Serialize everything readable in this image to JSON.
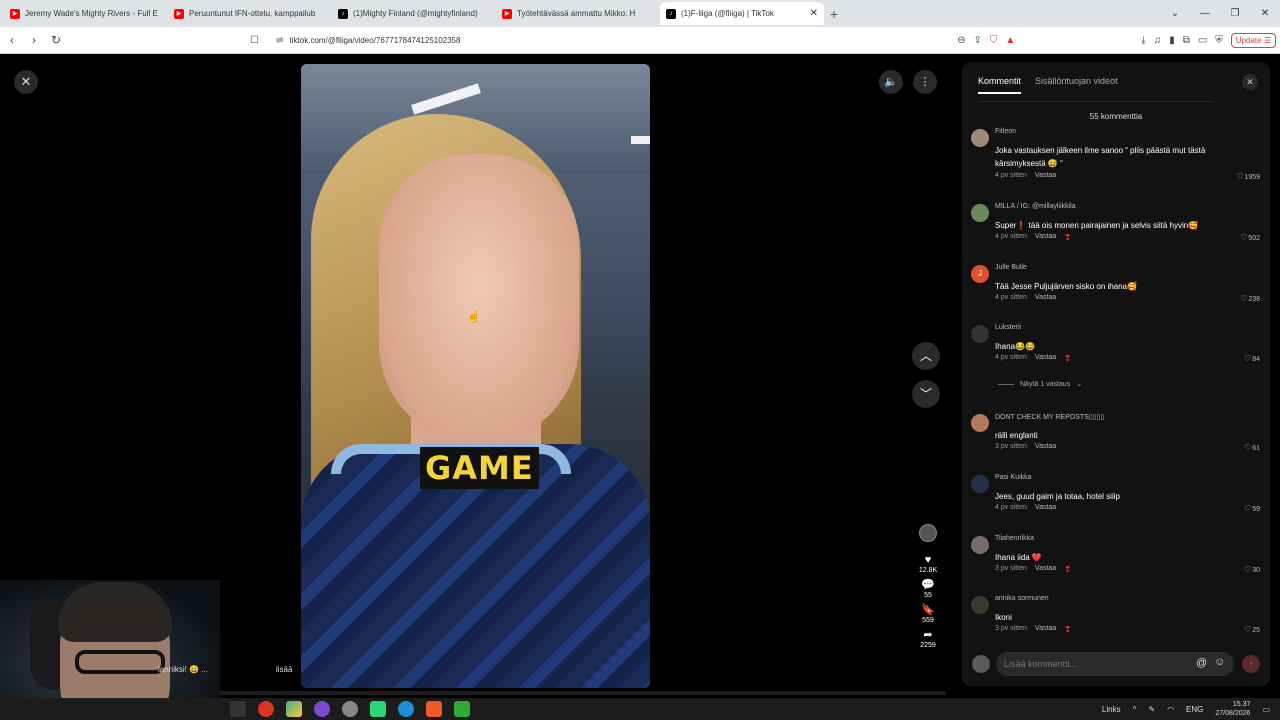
{
  "browser": {
    "tabs": [
      {
        "label": "Jeremy Wade's Mighty Rivers - Full E",
        "favicon_color": "#ff0000"
      },
      {
        "label": "Peruuntunut IFN-ottelu, kamppailub",
        "favicon_color": "#ff0000"
      },
      {
        "label": "(1)Mighty Finland (@mightyfinland)",
        "favicon_color": "#000000"
      },
      {
        "label": "Työtehtävässä ammattu Mikko: H",
        "favicon_color": "#ff0000"
      },
      {
        "label": "(1)F-liiga (@fliiga) | TikTok",
        "favicon_color": "#000000",
        "active": true
      }
    ],
    "url": "tiktok.com/@fliiga/video/7677178474125102358",
    "update_label": "Update"
  },
  "video": {
    "caption": "GAME",
    "description": "lanniksi! 😄 ...",
    "more_label": "lisää",
    "actions": {
      "likes": "12.8K",
      "comments": "55",
      "saves": "559",
      "shares": "2259"
    }
  },
  "panel": {
    "tabs": [
      "Kommentit",
      "Sisällöntuojan videot"
    ],
    "comment_count": "55 kommenttia",
    "show_replies": "Näytä 1 vastaus",
    "reply_label": "Vastaa",
    "input_placeholder": "Lisää kommentti...",
    "comments": [
      {
        "user": "Fitleon",
        "text": "Joka vastauksen jälkeen ilme sanoo “ pliis päästä mut tästä kärsimyksestä 😅 “",
        "time": "4 pv sitten",
        "likes": "1959",
        "avatar_color": "#a08b7a",
        "author_flag": false
      },
      {
        "user": "MILLA / IG: @millayliikkila",
        "text": "Super❗ tää ois monen pairajainen ja selvis siitä hyvin🥰",
        "time": "4 pv sitten",
        "likes": "502",
        "avatar_color": "#6d8a5c",
        "author_flag": true
      },
      {
        "user": "Julle Bulle",
        "text": "Tää Jesse Puljujärven sisko on ihana🥰",
        "time": "4 pv sitten",
        "likes": "238",
        "avatar_color": "#e0512d",
        "avatar_letter": "J",
        "author_flag": false
      },
      {
        "user": "Luksterii",
        "text": "Ihana😂😂",
        "time": "4 pv sitten",
        "likes": "84",
        "avatar_color": "#333333",
        "author_flag": true
      },
      {
        "user": "DONT CHECK MY REPOSTS▯▯▯▯",
        "text": "rälli englanti",
        "time": "3 pv sitten",
        "likes": "61",
        "avatar_color": "#b07a5a",
        "author_flag": false
      },
      {
        "user": "Pasi Kuikka",
        "text": "Jees, guud gaim ja totaa, hotel siiip",
        "time": "4 pv sitten",
        "likes": "59",
        "avatar_color": "#22304a",
        "author_flag": false
      },
      {
        "user": "Tiiahenriikka",
        "text": "Ihana iida ❤️",
        "time": "3 pv sitten",
        "likes": "30",
        "avatar_color": "#7a6a6a",
        "author_flag": true
      },
      {
        "user": "annika sormunen",
        "text": "Ikoni",
        "time": "3 pv sitten",
        "likes": "25",
        "avatar_color": "#3a3a30",
        "author_flag": true
      }
    ]
  },
  "taskbar": {
    "links": "Links",
    "lang": "ENG",
    "time": "15.37",
    "date": "27/08/2026"
  }
}
